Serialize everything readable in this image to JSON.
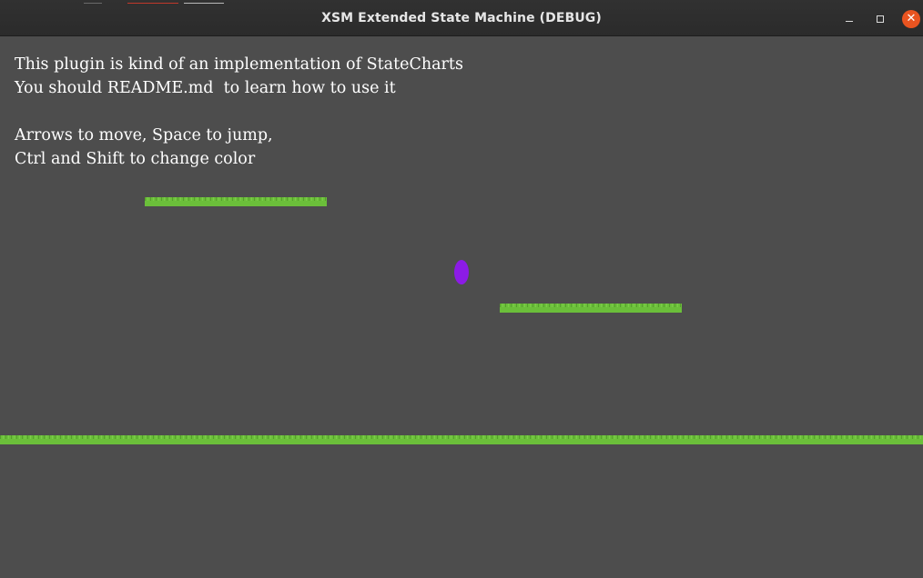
{
  "window": {
    "title": "XSM Extended State Machine (DEBUG)",
    "buttons": {
      "minimize_icon": "minimize-icon",
      "maximize_icon": "maximize-icon",
      "close_icon": "close-icon",
      "close_color": "#e95420"
    }
  },
  "game": {
    "background_color": "#4d4d4d",
    "help_text": [
      "This plugin is kind of an implementation of StateCharts",
      "You should README.md  to learn how to use it",
      "",
      "Arrows to move, Space to jump,",
      "Ctrl and Shift to change color"
    ],
    "platform_color": "#6bbf3a",
    "player_color": "#8c1be6"
  }
}
